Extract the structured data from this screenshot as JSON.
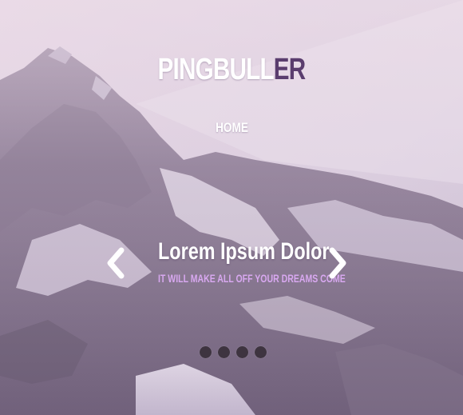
{
  "site": {
    "logo_main": "PINGBULL",
    "logo_accent": "ER"
  },
  "nav": {
    "items": [
      {
        "label": "HOME"
      }
    ]
  },
  "slider": {
    "title": "Lorem Ipsum Dolor",
    "subtitle": "IT WILL MAKE ALL OFF YOUR DREAMS COME",
    "prev_icon": "chevron-left-icon",
    "next_icon": "chevron-right-icon",
    "dots": [
      {
        "state": "inactive"
      },
      {
        "state": "inactive"
      },
      {
        "state": "inactive"
      },
      {
        "state": "inactive"
      }
    ]
  },
  "colors": {
    "logo_accent": "#5a3d6e",
    "subtitle": "#d8a8f0",
    "dot": "#3e3440"
  }
}
